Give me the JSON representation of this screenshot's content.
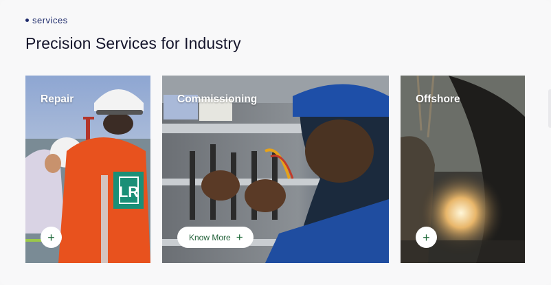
{
  "section": {
    "eyebrow": "services",
    "title": "Precision Services for Industry"
  },
  "cards": [
    {
      "label": "Repair",
      "button_icon": "+"
    },
    {
      "label": "Commissioning",
      "button_label": "Know More",
      "button_icon": "+"
    },
    {
      "label": "Offshore",
      "button_icon": "+"
    }
  ],
  "colors": {
    "accent_green": "#1f6a3a",
    "eyebrow_blue": "#1d2a6b",
    "worker_orange": "#e8521e",
    "logo_teal": "#1a8f77"
  },
  "logos": {
    "vest_badge": "LR"
  }
}
